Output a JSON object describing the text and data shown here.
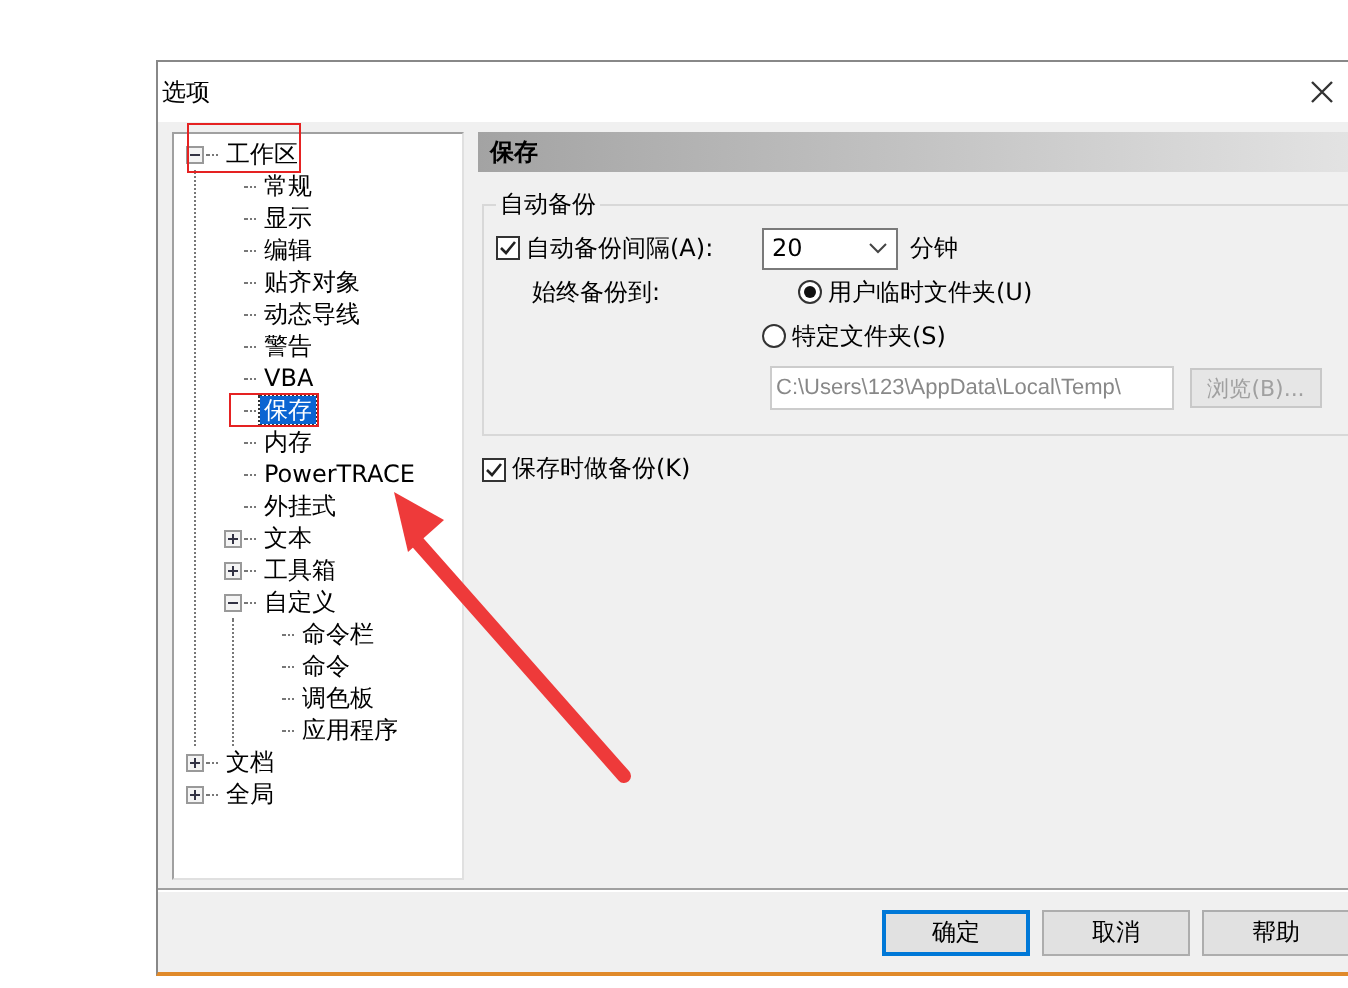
{
  "window": {
    "title": "选项"
  },
  "tree": [
    {
      "label": "工作区",
      "selected": false,
      "expanded": true,
      "children": [
        {
          "label": "常规",
          "selected": false
        },
        {
          "label": "显示",
          "selected": false
        },
        {
          "label": "编辑",
          "selected": false
        },
        {
          "label": "贴齐对象",
          "selected": false
        },
        {
          "label": "动态导线",
          "selected": false
        },
        {
          "label": "警告",
          "selected": false
        },
        {
          "label": "VBA",
          "selected": false
        },
        {
          "label": "保存",
          "selected": true
        },
        {
          "label": "内存",
          "selected": false
        },
        {
          "label": "PowerTRACE",
          "selected": false
        },
        {
          "label": "外挂式",
          "selected": false
        },
        {
          "label": "文本",
          "selected": false,
          "expanded": false
        },
        {
          "label": "工具箱",
          "selected": false,
          "expanded": false
        },
        {
          "label": "自定义",
          "selected": false,
          "expanded": true,
          "children": [
            {
              "label": "命令栏",
              "selected": false
            },
            {
              "label": "命令",
              "selected": false
            },
            {
              "label": "调色板",
              "selected": false
            },
            {
              "label": "应用程序",
              "selected": false
            }
          ]
        }
      ]
    },
    {
      "label": "文档",
      "selected": false,
      "expanded": false
    },
    {
      "label": "全局",
      "selected": false,
      "expanded": false
    }
  ],
  "panel": {
    "title": "保存",
    "group": {
      "title": "自动备份",
      "interval": {
        "label": "自动备份间隔(A):",
        "checked": true,
        "value": "20",
        "unit": "分钟"
      },
      "backup_to": {
        "label": "始终备份到:",
        "options": [
          {
            "label": "用户临时文件夹(U)",
            "selected": true
          },
          {
            "label": "特定文件夹(S)",
            "selected": false
          }
        ],
        "path": {
          "value": "C:\\Users\\123\\AppData\\Local\\Temp\\",
          "disabled": true
        },
        "browse": {
          "label": "浏览(B)...",
          "disabled": true
        }
      }
    },
    "save_backup": {
      "label": "保存时做备份(K)",
      "checked": true
    }
  },
  "buttons": [
    {
      "label": "确定",
      "default": true
    },
    {
      "label": "取消",
      "default": false
    },
    {
      "label": "帮助",
      "default": false
    }
  ]
}
